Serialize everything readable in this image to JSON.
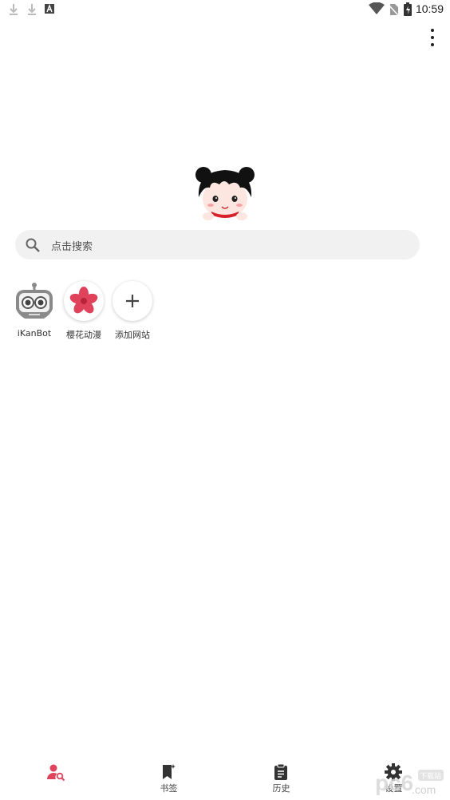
{
  "status_bar": {
    "time": "10:59",
    "icons": [
      "download-icon",
      "download-icon",
      "a-notification-icon",
      "wifi-icon",
      "no-sim-icon",
      "battery-charging-icon"
    ]
  },
  "toolbar": {
    "more_icon": "more-vert-icon"
  },
  "search": {
    "placeholder": "点击搜索",
    "icon": "search-icon"
  },
  "shortcuts": [
    {
      "label": "iKanBot",
      "icon": "robot-icon"
    },
    {
      "label": "樱花动漫",
      "icon": "sakura-flower-icon"
    },
    {
      "label": "添加网站",
      "icon": "plus-icon"
    }
  ],
  "bottom_nav": [
    {
      "label": "",
      "icon": "user-search-icon",
      "active": true
    },
    {
      "label": "书签",
      "icon": "bookmark-icon"
    },
    {
      "label": "历史",
      "icon": "clipboard-history-icon"
    },
    {
      "label": "设置",
      "icon": "gear-icon"
    }
  ],
  "colors": {
    "accent": "#e0425b",
    "search_bg": "#f1f1f1",
    "icon_dark": "#333333"
  },
  "watermark": {
    "text_main": "pc6",
    "text_sub": ".com",
    "text_badge": "下载站"
  }
}
